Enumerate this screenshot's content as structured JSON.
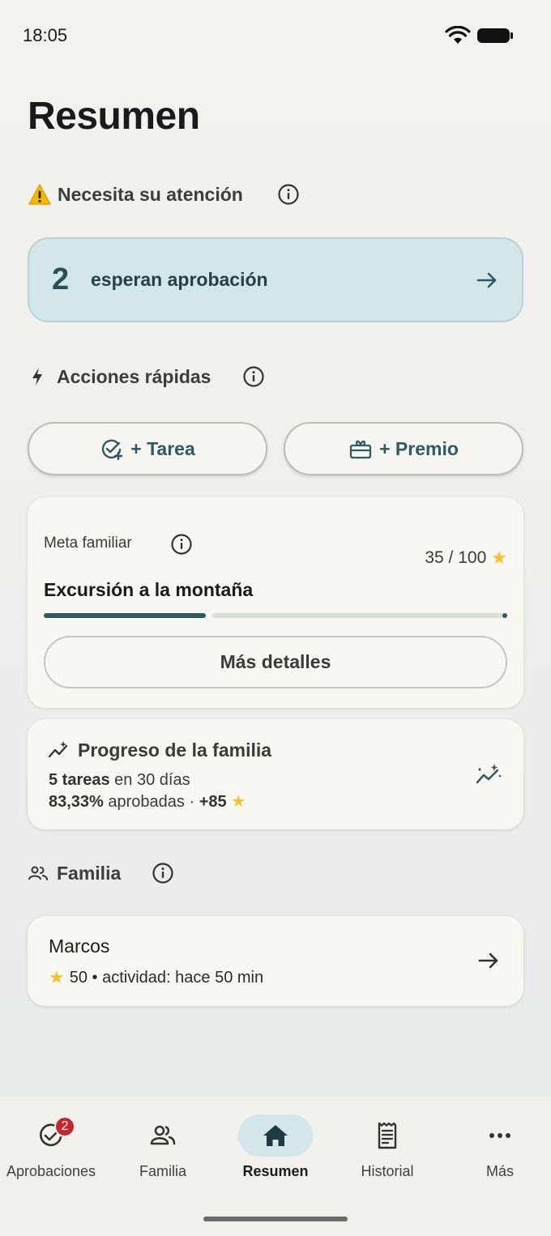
{
  "status_bar": {
    "time": "18:05"
  },
  "page": {
    "title": "Resumen"
  },
  "attention": {
    "header": "Necesita su atención",
    "approval_count": "2",
    "approval_text": "esperan aprobación"
  },
  "quick_actions": {
    "header": "Acciones rápidas",
    "task_label": "+ Tarea",
    "reward_label": "+ Premio"
  },
  "family_goal": {
    "label": "Meta familiar",
    "points": "35 / 100",
    "progress": 0.35,
    "title": "Excursión a la montaña",
    "details_label": "Más detalles"
  },
  "family_progress": {
    "title": "Progreso de la familia",
    "tasks_count": "5 tareas",
    "tasks_period": " en 30 días",
    "approved_pct": "83,33%",
    "approved_text": " aprobadas · ",
    "stars_delta": "+85"
  },
  "family": {
    "header": "Familia",
    "members": [
      {
        "name": "Marcos",
        "stars": "50",
        "activity": " • actividad: hace 50 min"
      }
    ]
  },
  "bottom_nav": {
    "items": [
      {
        "label": "Aprobaciones",
        "badge": "2"
      },
      {
        "label": "Familia"
      },
      {
        "label": "Resumen"
      },
      {
        "label": "Historial"
      },
      {
        "label": "Más"
      }
    ],
    "active_index": 2
  },
  "colors": {
    "accent": "#2f5a62",
    "highlight_bg": "#d3e6ea",
    "badge": "#c8262c",
    "star": "#f6c22c"
  }
}
